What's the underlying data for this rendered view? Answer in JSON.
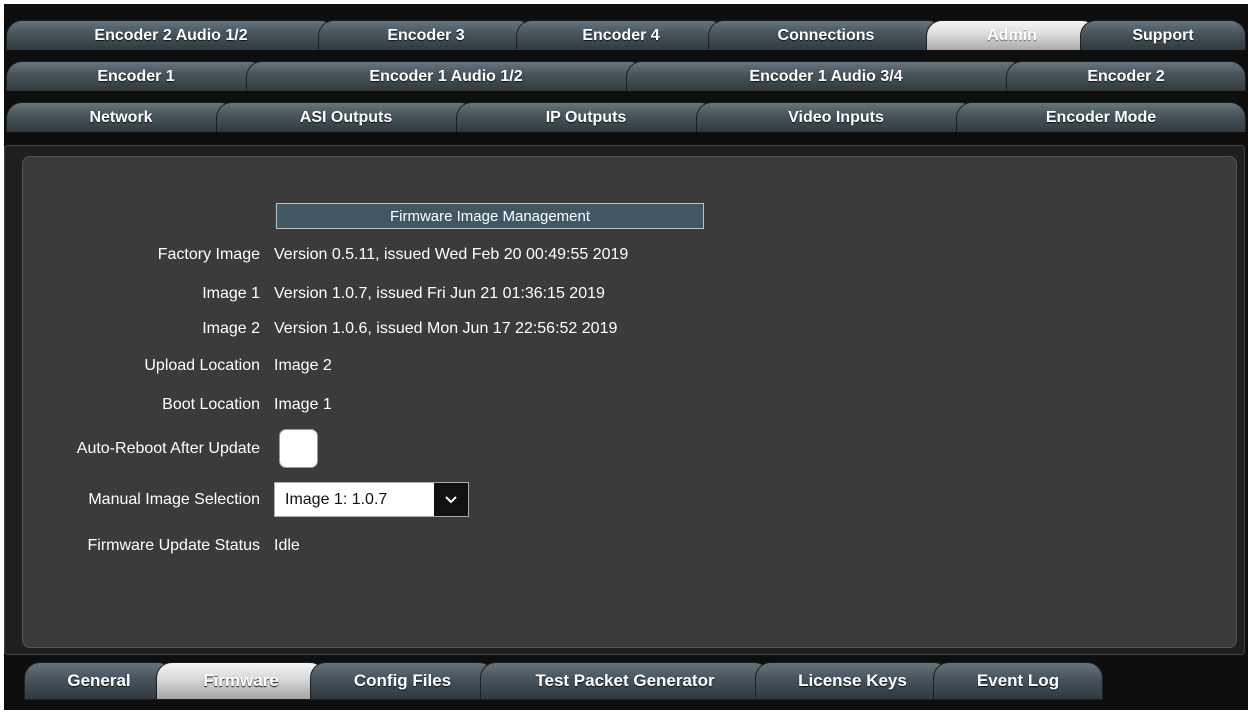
{
  "tabs_row1": [
    "Encoder 2 Audio 1/2",
    "Encoder 3",
    "Encoder 4",
    "Connections",
    "Admin",
    "Support"
  ],
  "tabs_row2": [
    "Encoder 1",
    "Encoder 1 Audio 1/2",
    "Encoder 1 Audio 3/4",
    "Encoder 2"
  ],
  "tabs_row3": [
    "Network",
    "ASI Outputs",
    "IP Outputs",
    "Video Inputs",
    "Encoder Mode"
  ],
  "active_top_tab": "Admin",
  "section_title": "Firmware Image Management",
  "fields": {
    "factory_image": {
      "label": "Factory Image",
      "value": "Version 0.5.11, issued Wed Feb 20 00:49:55 2019"
    },
    "image1": {
      "label": "Image 1",
      "value": "Version 1.0.7, issued Fri Jun 21 01:36:15 2019"
    },
    "image2": {
      "label": "Image 2",
      "value": "Version 1.0.6, issued Mon Jun 17 22:56:52 2019"
    },
    "upload_location": {
      "label": "Upload Location",
      "value": "Image 2"
    },
    "boot_location": {
      "label": "Boot Location",
      "value": "Image 1"
    },
    "auto_reboot": {
      "label": "Auto-Reboot After Update",
      "checked": false
    },
    "manual_selection": {
      "label": "Manual Image Selection",
      "value": "Image 1: 1.0.7"
    },
    "update_status": {
      "label": "Firmware Update Status",
      "value": "Idle"
    }
  },
  "bottom_tabs": [
    "General",
    "Firmware",
    "Config Files",
    "Test Packet Generator",
    "License Keys",
    "Event Log"
  ],
  "active_bottom_tab": "Firmware",
  "colors": {
    "header_bg": "#415864",
    "panel_bg": "#3b3b3b",
    "tab_dark": "#4a565d"
  }
}
